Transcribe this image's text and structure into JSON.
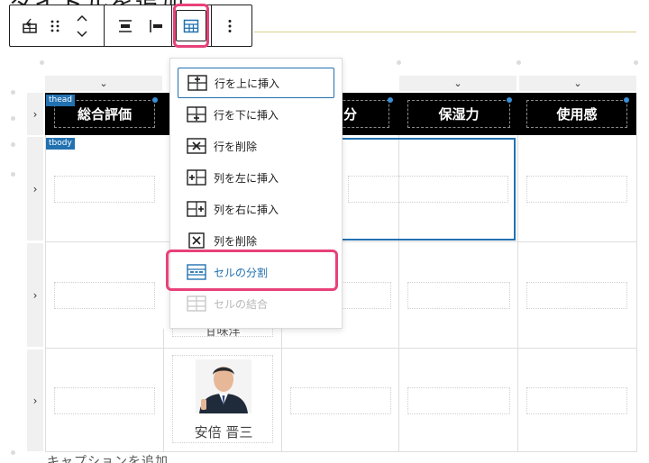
{
  "page": {
    "heading": "タイトルを追加",
    "footer_hint": "キャプションを追加"
  },
  "toolbar": {
    "items": [
      {
        "name": "block-type-icon",
        "glyph": "⊞"
      },
      {
        "name": "drag-handle-icon",
        "glyph": "⠿"
      },
      {
        "name": "move-up-down-icon",
        "glyph": "⌃⌄"
      },
      {
        "name": "align-center-icon",
        "glyph": "≡"
      },
      {
        "name": "align-left-icon",
        "glyph": "▕▬"
      },
      {
        "name": "table-edit-icon",
        "glyph": "▦"
      },
      {
        "name": "more-options-icon",
        "glyph": "⋮"
      }
    ]
  },
  "table": {
    "thead_tag": "thead",
    "tbody_tag": "tbody",
    "col_toggle": "⌄",
    "row_toggle": "›",
    "headers": [
      "総合評価",
      "分",
      "保湿力",
      "使用感"
    ],
    "portrait_caption": "安倍 晋三",
    "partial_caption": "甘味洋"
  },
  "menu": {
    "items": [
      {
        "label": "行を上に挿入",
        "icon": "row-insert-before-icon",
        "state": "focused"
      },
      {
        "label": "行を下に挿入",
        "icon": "row-insert-after-icon",
        "state": "normal"
      },
      {
        "label": "行を削除",
        "icon": "row-delete-icon",
        "state": "normal"
      },
      {
        "label": "列を左に挿入",
        "icon": "column-insert-before-icon",
        "state": "normal"
      },
      {
        "label": "列を右に挿入",
        "icon": "column-insert-after-icon",
        "state": "normal"
      },
      {
        "label": "列を削除",
        "icon": "column-delete-icon",
        "state": "normal"
      },
      {
        "label": "セルの分割",
        "icon": "cell-split-icon",
        "state": "highlighted"
      },
      {
        "label": "セルの結合",
        "icon": "cell-merge-icon",
        "state": "disabled"
      }
    ]
  },
  "colors": {
    "accent": "#2271b1",
    "highlight": "#e8417a",
    "thead_bg": "#000000"
  }
}
